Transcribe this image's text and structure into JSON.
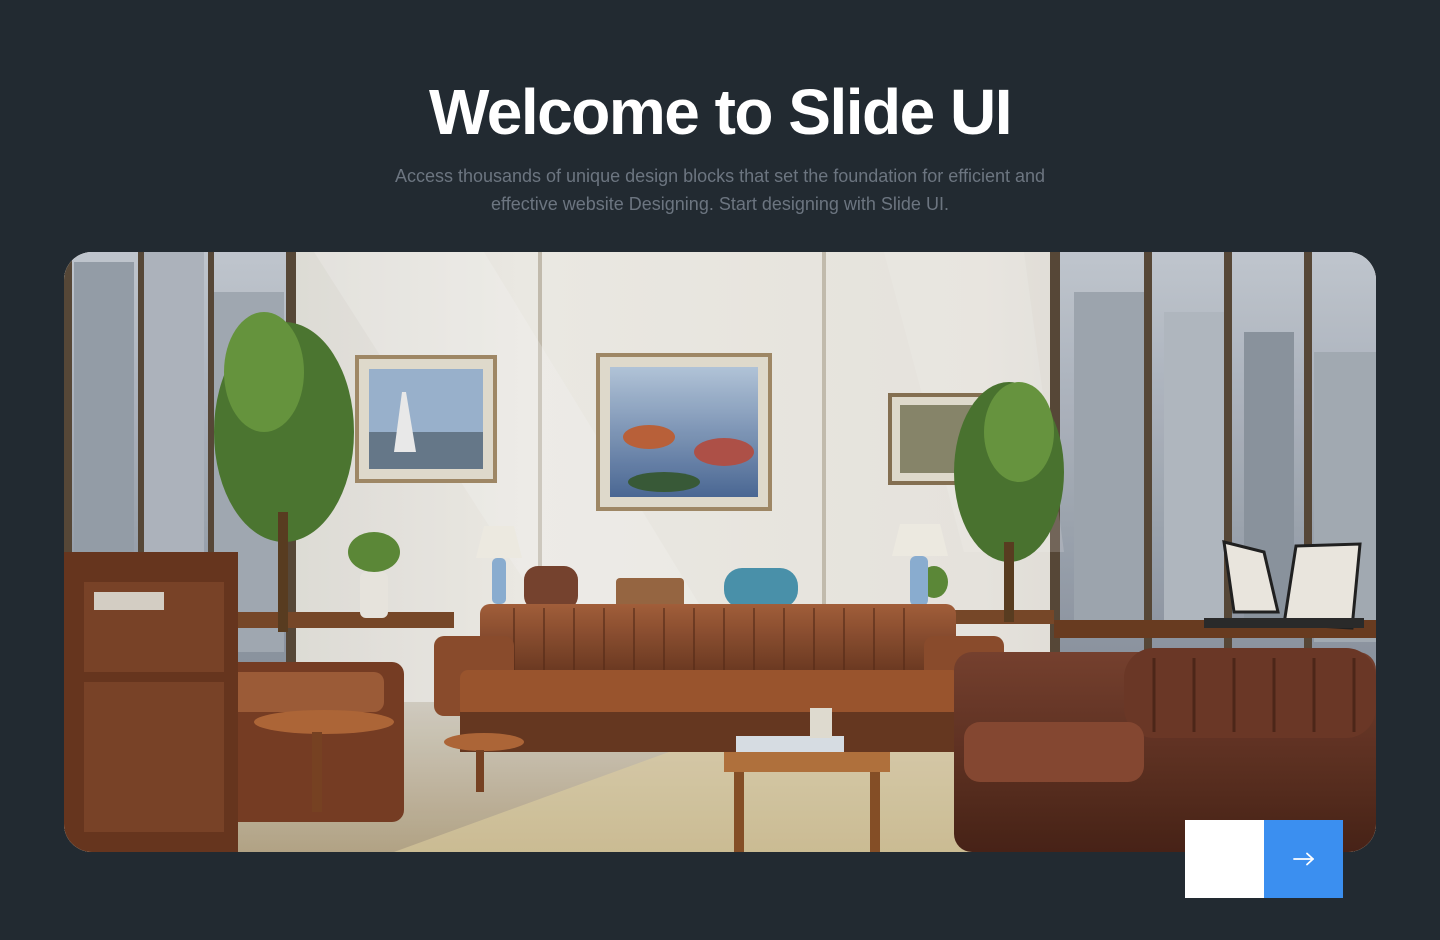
{
  "hero": {
    "title": "Welcome to Slide UI",
    "subtitle": "Access thousands of unique design blocks that set the foundation for efficient and effective website Designing. Start designing with Slide UI."
  },
  "slider": {
    "image_icon": "office-lounge-image",
    "prev_icon": "arrow-left-icon",
    "next_icon": "arrow-right-icon",
    "colors": {
      "background": "#222a31",
      "prev_button": "#ffffff",
      "next_button": "#3b8ff0"
    }
  }
}
